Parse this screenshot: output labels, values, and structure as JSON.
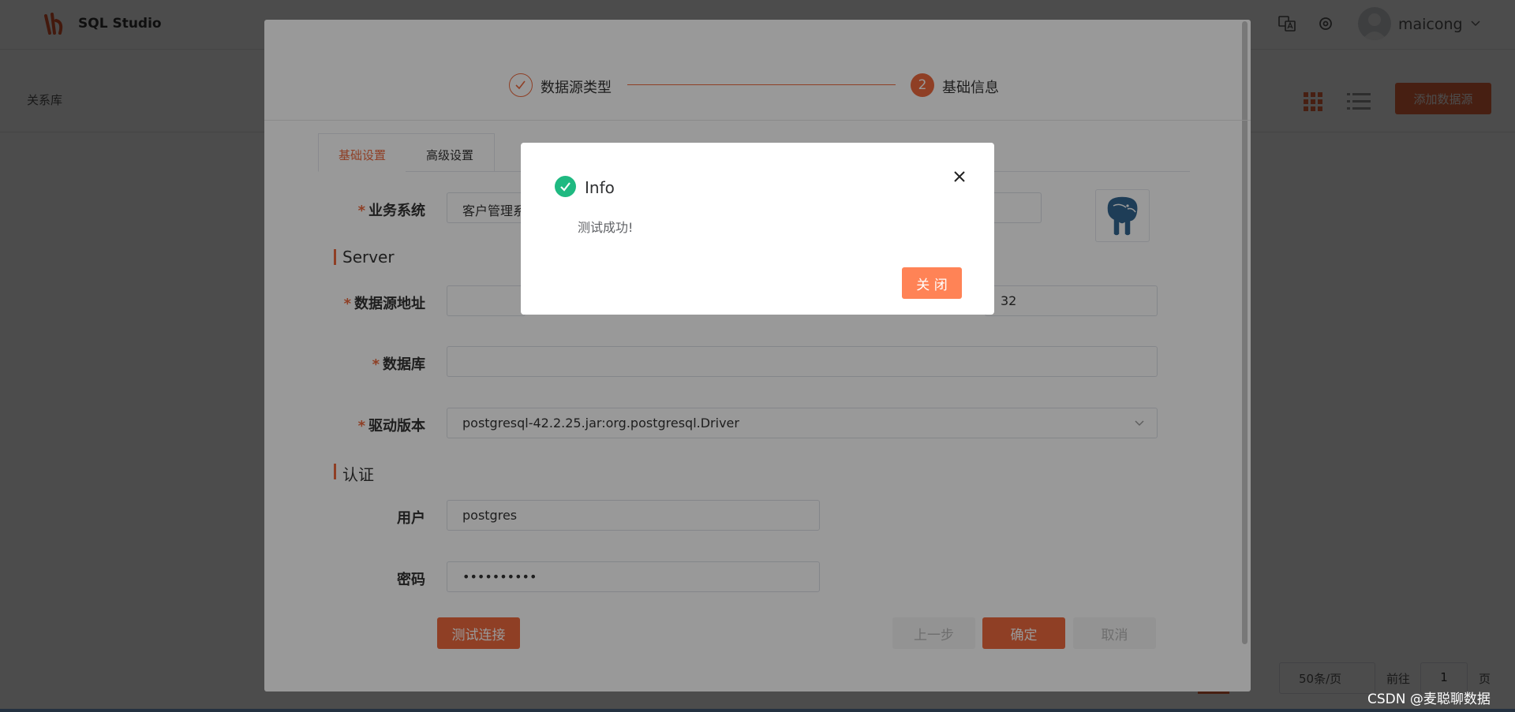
{
  "app": {
    "title": "SQL Studio",
    "user": "maicong"
  },
  "page": {
    "breadcrumb": "关系库",
    "add_button": "添加数据源"
  },
  "pagination": {
    "page_size": "50条/页",
    "goto_label": "前往",
    "page_number": "1",
    "page_unit": "页"
  },
  "dialog": {
    "steps": [
      {
        "label": "数据源类型",
        "status": "done"
      },
      {
        "number": "2",
        "label": "基础信息",
        "status": "active"
      }
    ],
    "tabs": [
      "基础设置",
      "高级设置"
    ],
    "form": {
      "biz_system": {
        "label": "业务系统",
        "value": "客户管理系"
      },
      "server_section": "Server",
      "address": {
        "label": "数据源地址",
        "value": "32"
      },
      "database": {
        "label": "数据库"
      },
      "driver": {
        "label": "驱动版本",
        "value": "postgresql-42.2.25.jar:org.postgresql.Driver"
      },
      "auth_section": "认证",
      "user": {
        "label": "用户",
        "value": "postgres"
      },
      "password": {
        "label": "密码",
        "value": "••••••••••"
      }
    },
    "buttons": {
      "test": "测试连接",
      "prev": "上一步",
      "ok": "确定",
      "cancel": "取消"
    }
  },
  "message_box": {
    "title": "Info",
    "text": "测试成功!",
    "close_button": "关 闭"
  },
  "watermark": "CSDN @麦聪聊数据",
  "colors": {
    "accent": "#ee6a3f",
    "success": "#1fb981",
    "close_button": "#ff8356"
  }
}
